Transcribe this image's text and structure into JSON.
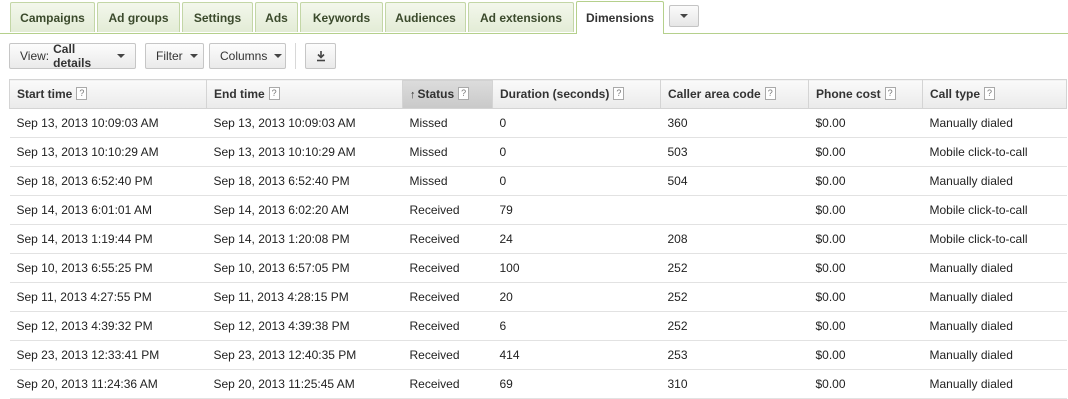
{
  "tabs": [
    {
      "label": "Campaigns"
    },
    {
      "label": "Ad groups"
    },
    {
      "label": "Settings"
    },
    {
      "label": "Ads"
    },
    {
      "label": "Keywords"
    },
    {
      "label": "Audiences"
    },
    {
      "label": "Ad extensions"
    },
    {
      "label": "Dimensions",
      "active": true
    }
  ],
  "toolbar": {
    "view_prefix": "View:",
    "view_value": "Call details",
    "filter_label": "Filter",
    "columns_label": "Columns",
    "download_icon": "download-icon"
  },
  "table": {
    "help_glyph": "?",
    "sort_glyph": "↑",
    "columns": [
      "Start time",
      "End time",
      "Status",
      "Duration (seconds)",
      "Caller area code",
      "Phone cost",
      "Call type"
    ],
    "sorted_column": "Status",
    "rows": [
      [
        "Sep 13, 2013 10:09:03 AM",
        "Sep 13, 2013 10:09:03 AM",
        "Missed",
        "0",
        "360",
        "$0.00",
        "Manually dialed"
      ],
      [
        "Sep 13, 2013 10:10:29 AM",
        "Sep 13, 2013 10:10:29 AM",
        "Missed",
        "0",
        "503",
        "$0.00",
        "Mobile click-to-call"
      ],
      [
        "Sep 18, 2013 6:52:40 PM",
        "Sep 18, 2013 6:52:40 PM",
        "Missed",
        "0",
        "504",
        "$0.00",
        "Manually dialed"
      ],
      [
        "Sep 14, 2013 6:01:01 AM",
        "Sep 14, 2013 6:02:20 AM",
        "Received",
        "79",
        "",
        "$0.00",
        "Mobile click-to-call"
      ],
      [
        "Sep 14, 2013 1:19:44 PM",
        "Sep 14, 2013 1:20:08 PM",
        "Received",
        "24",
        "208",
        "$0.00",
        "Mobile click-to-call"
      ],
      [
        "Sep 10, 2013 6:55:25 PM",
        "Sep 10, 2013 6:57:05 PM",
        "Received",
        "100",
        "252",
        "$0.00",
        "Manually dialed"
      ],
      [
        "Sep 11, 2013 4:27:55 PM",
        "Sep 11, 2013 4:28:15 PM",
        "Received",
        "20",
        "252",
        "$0.00",
        "Manually dialed"
      ],
      [
        "Sep 12, 2013 4:39:32 PM",
        "Sep 12, 2013 4:39:38 PM",
        "Received",
        "6",
        "252",
        "$0.00",
        "Manually dialed"
      ],
      [
        "Sep 23, 2013 12:33:41 PM",
        "Sep 23, 2013 12:40:35 PM",
        "Received",
        "414",
        "253",
        "$0.00",
        "Manually dialed"
      ],
      [
        "Sep 20, 2013 11:24:36 AM",
        "Sep 20, 2013 11:25:45 AM",
        "Received",
        "69",
        "310",
        "$0.00",
        "Manually dialed"
      ]
    ]
  }
}
